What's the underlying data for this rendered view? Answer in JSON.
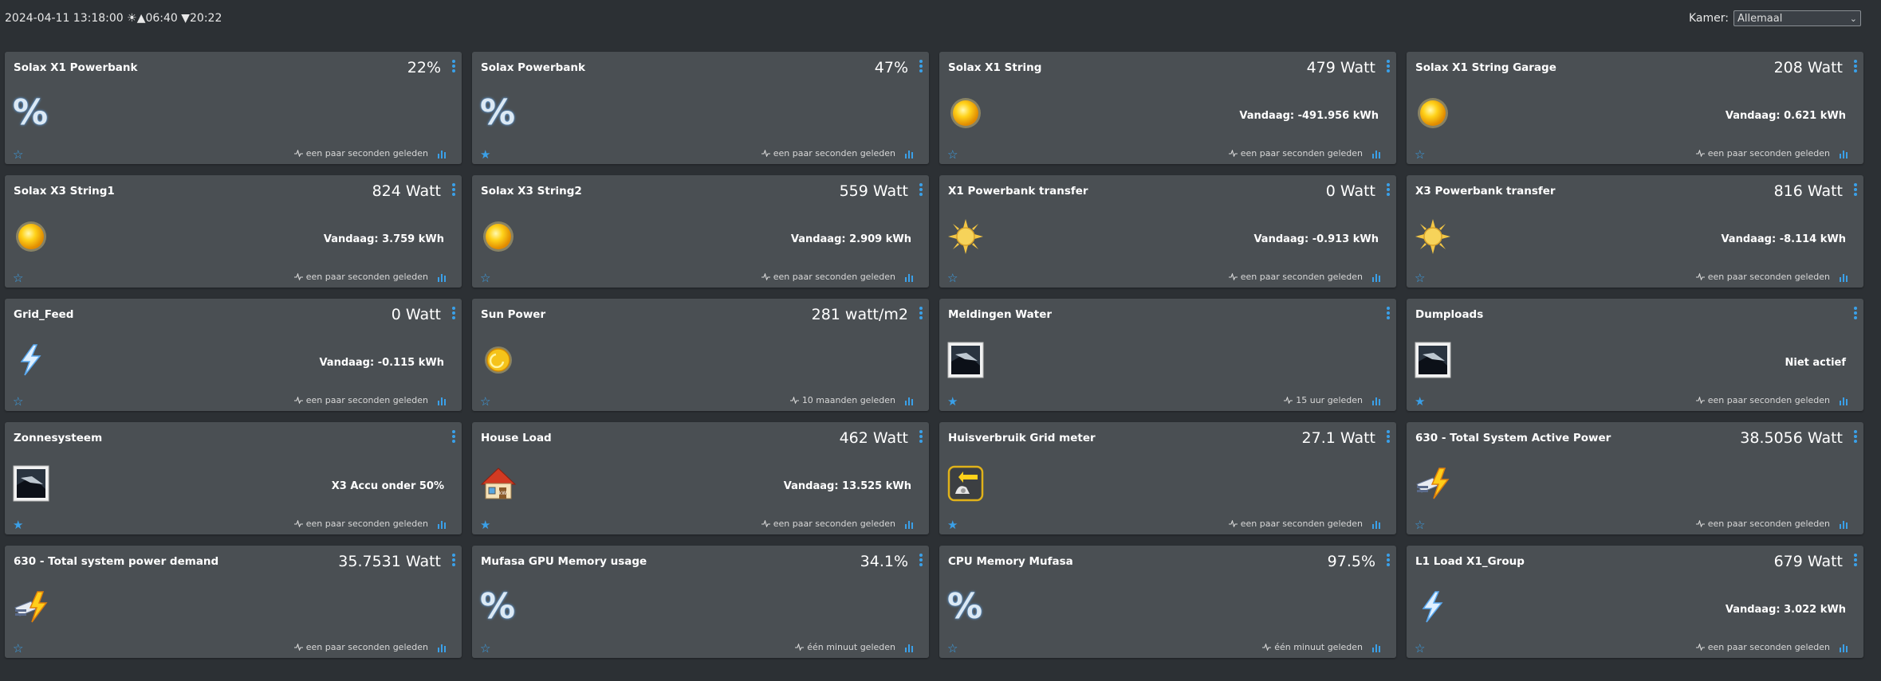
{
  "header": {
    "datetime": "2024-04-11 13:18:00 ☀▲06:40 ▼20:22",
    "room_label": "Kamer:",
    "room_value": "Allemaal"
  },
  "colors": {
    "accent": "#3aa0e8",
    "card_bg": "#4a4f53",
    "page_bg": "#2c3034"
  },
  "devices": [
    {
      "name": "Solax X1 Powerbank",
      "value": "22%",
      "sub": "",
      "updated": "een paar seconden geleden",
      "icon": "percent-icon",
      "favorite": false
    },
    {
      "name": "Solax Powerbank",
      "value": "47%",
      "sub": "",
      "updated": "een paar seconden geleden",
      "icon": "percent-icon",
      "favorite": true
    },
    {
      "name": "Solax X1 String",
      "value": "479 Watt",
      "sub": "Vandaag: -491.956 kWh",
      "updated": "een paar seconden geleden",
      "icon": "sun-icon",
      "favorite": false
    },
    {
      "name": "Solax X1 String Garage",
      "value": "208 Watt",
      "sub": "Vandaag: 0.621 kWh",
      "updated": "een paar seconden geleden",
      "icon": "sun-icon",
      "favorite": false
    },
    {
      "name": "Solax X3 String1",
      "value": "824 Watt",
      "sub": "Vandaag: 3.759 kWh",
      "updated": "een paar seconden geleden",
      "icon": "sun-icon",
      "favorite": false
    },
    {
      "name": "Solax X3 String2",
      "value": "559 Watt",
      "sub": "Vandaag: 2.909 kWh",
      "updated": "een paar seconden geleden",
      "icon": "sun-icon",
      "favorite": false
    },
    {
      "name": "X1 Powerbank transfer",
      "value": "0 Watt",
      "sub": "Vandaag: -0.913 kWh",
      "updated": "een paar seconden geleden",
      "icon": "sun-rays-icon",
      "favorite": false
    },
    {
      "name": "X3 Powerbank transfer",
      "value": "816 Watt",
      "sub": "Vandaag: -8.114 kWh",
      "updated": "een paar seconden geleden",
      "icon": "sun-rays-icon",
      "favorite": false
    },
    {
      "name": "Grid_Feed",
      "value": "0 Watt",
      "sub": "Vandaag: -0.115 kWh",
      "updated": "een paar seconden geleden",
      "icon": "lightning-icon",
      "favorite": false
    },
    {
      "name": "Sun Power",
      "value": "281 watt/m2",
      "sub": "",
      "updated": "10 maanden geleden",
      "icon": "sun-power-icon",
      "favorite": false
    },
    {
      "name": "Meldingen Water",
      "value": "",
      "sub": "",
      "updated": "15 uur geleden",
      "icon": "screen-icon",
      "favorite": true
    },
    {
      "name": "Dumploads",
      "value": "",
      "sub": "Niet actief",
      "updated": "een paar seconden geleden",
      "icon": "screen-icon",
      "favorite": true
    },
    {
      "name": "Zonnesysteem",
      "value": "",
      "sub": "X3 Accu onder 50%",
      "updated": "een paar seconden geleden",
      "icon": "screen-icon",
      "favorite": true
    },
    {
      "name": "House Load",
      "value": "462 Watt",
      "sub": "Vandaag: 13.525 kWh",
      "updated": "een paar seconden geleden",
      "icon": "house-icon",
      "favorite": true
    },
    {
      "name": "Huisverbruik Grid meter",
      "value": "27.1 Watt",
      "sub": "",
      "updated": "een paar seconden geleden",
      "icon": "meter-icon",
      "favorite": true
    },
    {
      "name": "630 - Total System Active Power",
      "value": "38.5056 Watt",
      "sub": "",
      "updated": "een paar seconden geleden",
      "icon": "plug-bolt-icon",
      "favorite": false
    },
    {
      "name": "630 - Total system power demand",
      "value": "35.7531 Watt",
      "sub": "",
      "updated": "een paar seconden geleden",
      "icon": "plug-bolt-icon",
      "favorite": false
    },
    {
      "name": "Mufasa GPU Memory usage",
      "value": "34.1%",
      "sub": "",
      "updated": "één minuut geleden",
      "icon": "percent-icon",
      "favorite": false
    },
    {
      "name": "CPU Memory Mufasa",
      "value": "97.5%",
      "sub": "",
      "updated": "één minuut geleden",
      "icon": "percent-icon",
      "favorite": false
    },
    {
      "name": "L1 Load X1_Group",
      "value": "679 Watt",
      "sub": "Vandaag: 3.022 kWh",
      "updated": "een paar seconden geleden",
      "icon": "lightning-icon",
      "favorite": false
    }
  ]
}
